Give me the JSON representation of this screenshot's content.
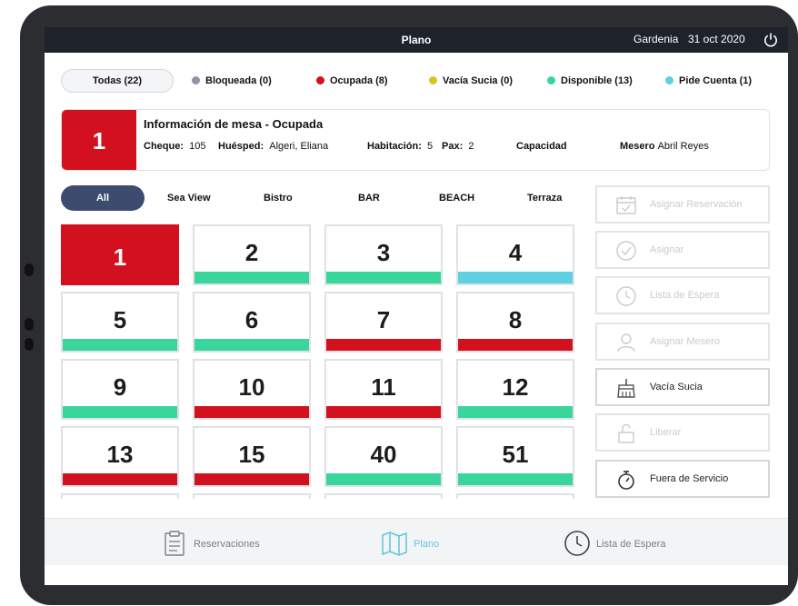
{
  "header": {
    "title": "Plano",
    "hotel": "Gardenia",
    "date": "31 oct 2020"
  },
  "colors": {
    "bloqueada": "#8f93a6",
    "ocupada": "#d3101e",
    "vacia_sucia": "#d6c623",
    "disponible": "#39d69c",
    "pide_cuenta": "#5fcfe3"
  },
  "filters": {
    "all": "Todas (22)",
    "bloqueada": "Bloqueada (0)",
    "ocupada": "Ocupada (8)",
    "vacia_sucia": "Vacía Sucia (0)",
    "disponible": "Disponible (13)",
    "pide_cuenta": "Pide Cuenta (1)"
  },
  "info": {
    "number": "1",
    "title": "Información de mesa - Ocupada",
    "cheque_label": "Cheque:",
    "cheque": "105",
    "huesped_label": "Huésped:",
    "huesped": "Algeri, Eliana",
    "habitacion_label": "Habitación:",
    "habitacion": "5",
    "pax_label": "Pax:",
    "pax": "2",
    "capacidad_label": "Capacidad",
    "mesero_label": "Mesero",
    "mesero": "Abril Reyes"
  },
  "areas": [
    "All",
    "Sea View",
    "Bistro",
    "BAR",
    "BEACH",
    "Terraza"
  ],
  "tables": [
    {
      "number": "1",
      "status": "ocupada",
      "selected": true
    },
    {
      "number": "2",
      "status": "disponible"
    },
    {
      "number": "3",
      "status": "disponible"
    },
    {
      "number": "4",
      "status": "pide_cuenta"
    },
    {
      "number": "5",
      "status": "disponible"
    },
    {
      "number": "6",
      "status": "disponible"
    },
    {
      "number": "7",
      "status": "ocupada"
    },
    {
      "number": "8",
      "status": "ocupada"
    },
    {
      "number": "9",
      "status": "disponible"
    },
    {
      "number": "10",
      "status": "ocupada"
    },
    {
      "number": "11",
      "status": "ocupada"
    },
    {
      "number": "12",
      "status": "disponible"
    },
    {
      "number": "13",
      "status": "ocupada"
    },
    {
      "number": "15",
      "status": "ocupada"
    },
    {
      "number": "40",
      "status": "disponible"
    },
    {
      "number": "51",
      "status": "disponible"
    }
  ],
  "actions": {
    "asignar_reservacion": "Asignar Reservación",
    "asignar": "Asignar",
    "lista_espera": "Lista de Espera",
    "asignar_mesero": "Asignar Mesero",
    "vacia_sucia": "Vacía Sucia",
    "liberar": "Liberar",
    "fuera_servicio": "Fuera de Servicio"
  },
  "bottom": {
    "reservaciones": "Reservaciones",
    "plano": "Plano",
    "lista_espera": "Lista de Espera"
  }
}
